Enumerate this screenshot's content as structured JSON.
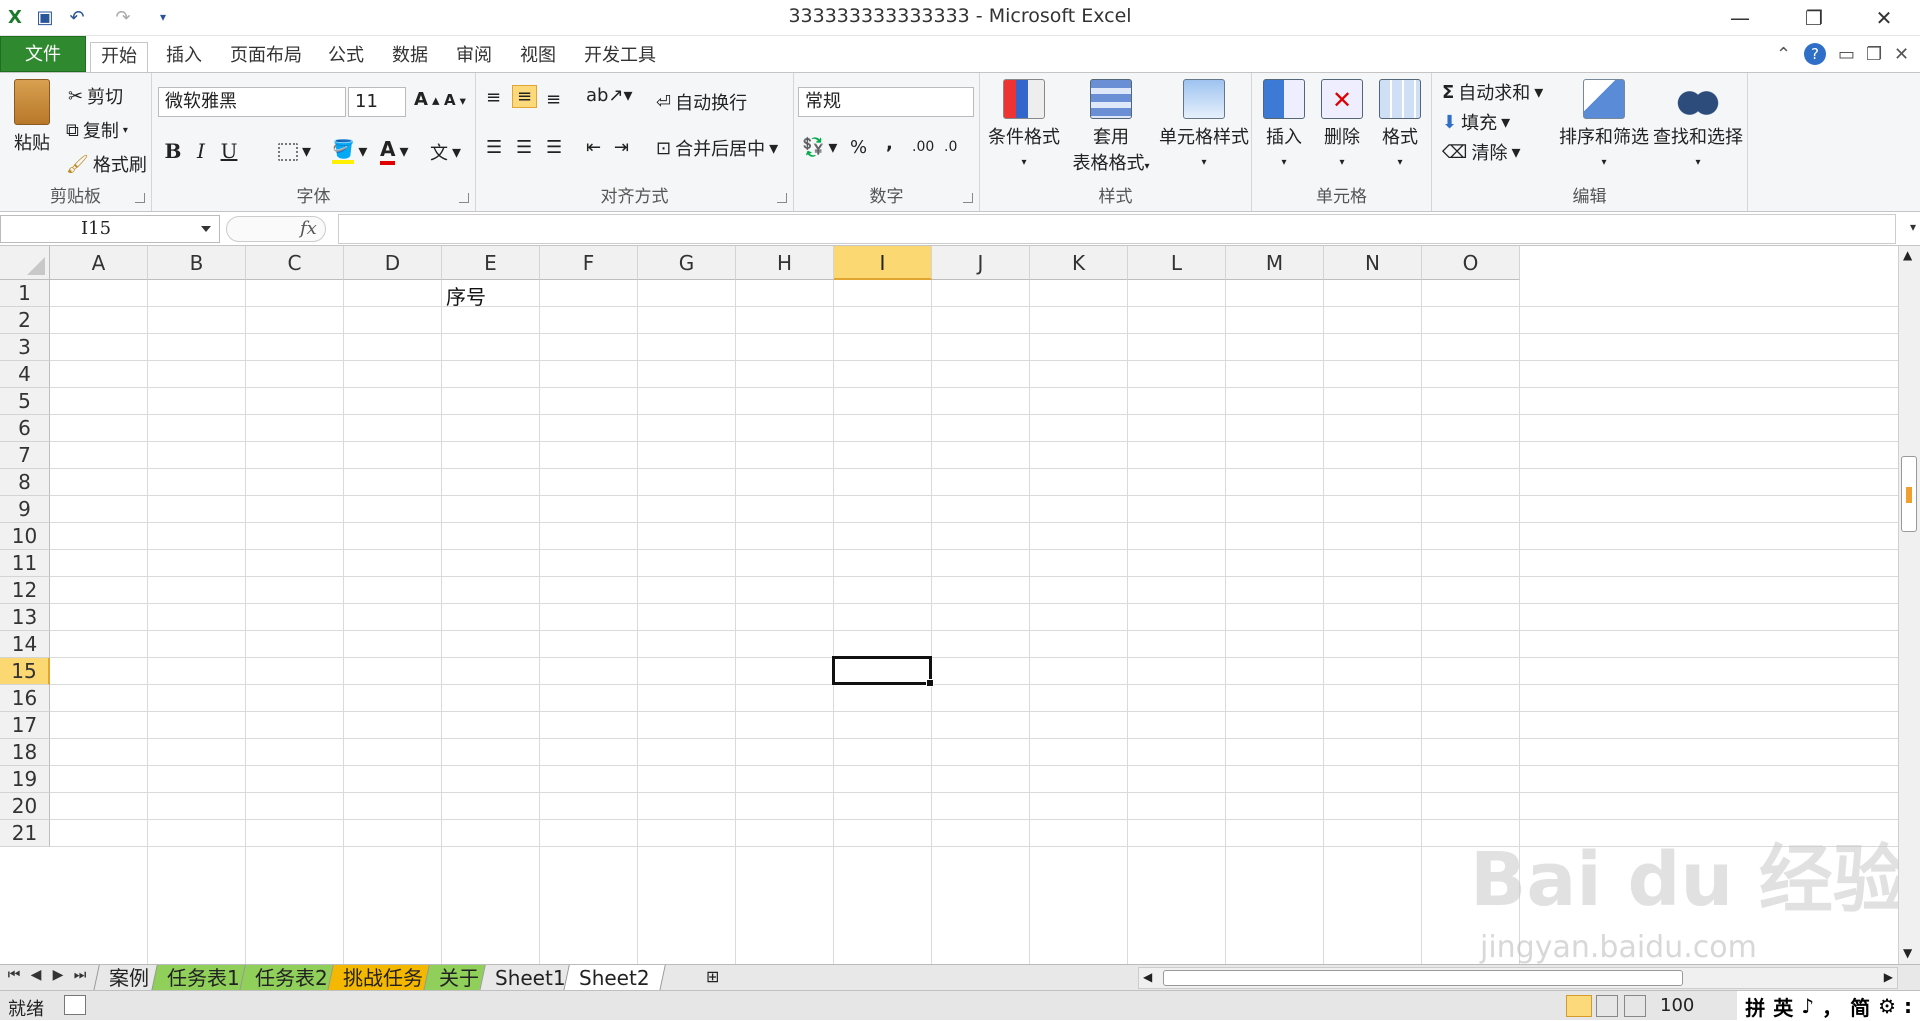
{
  "window": {
    "title": "333333333333333 - Microsoft Excel"
  },
  "tabs": {
    "file": "文件",
    "home": "开始",
    "insert": "插入",
    "layout": "页面布局",
    "formulas": "公式",
    "data": "数据",
    "review": "审阅",
    "view": "视图",
    "developer": "开发工具"
  },
  "clipboard": {
    "paste": "粘贴",
    "cut": "剪切",
    "copy": "复制",
    "painter": "格式刷",
    "label": "剪贴板"
  },
  "font": {
    "name": "微软雅黑",
    "size": "11",
    "label": "字体",
    "bold": "B",
    "italic": "I",
    "underline": "U"
  },
  "align": {
    "wrap": "自动换行",
    "merge": "合并后居中",
    "label": "对齐方式"
  },
  "number": {
    "format": "常规",
    "percent": "%",
    "comma": ",",
    "label": "数字"
  },
  "styles": {
    "cond": "条件格式",
    "table1": "套用",
    "table2": "表格格式",
    "cell": "单元格样式",
    "label": "样式"
  },
  "cells": {
    "insert": "插入",
    "delete": "删除",
    "format": "格式",
    "label": "单元格"
  },
  "editing": {
    "autosum": "自动求和",
    "fill": "填充",
    "clear": "清除",
    "sort": "排序和筛选",
    "find": "查找和选择",
    "label": "编辑"
  },
  "formula_bar": {
    "name_box": "I15",
    "fx": "fx",
    "value": ""
  },
  "columns": [
    "A",
    "B",
    "C",
    "D",
    "E",
    "F",
    "G",
    "H",
    "I",
    "J",
    "K",
    "L",
    "M",
    "N",
    "O"
  ],
  "rows": [
    "1",
    "2",
    "3",
    "4",
    "5",
    "6",
    "7",
    "8",
    "9",
    "10",
    "11",
    "12",
    "13",
    "14",
    "15",
    "16",
    "17",
    "18",
    "19",
    "20",
    "21"
  ],
  "selected": {
    "column": "I",
    "row": "15"
  },
  "cell_E1": "序号",
  "sheets": [
    {
      "name": "案例",
      "color": "#e8e8e8"
    },
    {
      "name": "任务表1",
      "color": "#8fcf5a"
    },
    {
      "name": "任务表2",
      "color": "#8fcf5a"
    },
    {
      "name": "挑战任务",
      "color": "#f5b800"
    },
    {
      "name": "关于",
      "color": "#8fcf5a"
    },
    {
      "name": "Sheet1",
      "color": "#e8e8e8"
    },
    {
      "name": "Sheet2",
      "color": "#ffffff"
    }
  ],
  "status": {
    "ready": "就绪",
    "zoom": "100"
  },
  "ime": [
    "拼",
    "英",
    "♪",
    "，",
    "简",
    "⚙",
    ":"
  ],
  "watermark": {
    "main": "Bai du 经验",
    "sub": "jingyan.baidu.com"
  }
}
